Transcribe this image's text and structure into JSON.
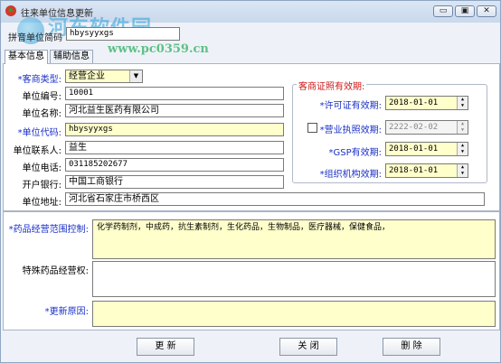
{
  "window": {
    "title": "往来单位信息更新",
    "controls": {
      "minimize": "▭",
      "restore": "▣",
      "close": "✕"
    }
  },
  "watermark": {
    "text": "河东软件园",
    "url": "www.pc0359.cn"
  },
  "search": {
    "label": "拼音单位简码",
    "value": "hbysyyxgs"
  },
  "tabs": [
    {
      "label": "基本信息",
      "active": true
    },
    {
      "label": "辅助信息",
      "active": false
    }
  ],
  "form": {
    "type": {
      "label": "*客商类型:",
      "value": "经营企业"
    },
    "code": {
      "label": "单位编号:",
      "value": "10001"
    },
    "name": {
      "label": "单位名称:",
      "value": "河北益生医药有限公司"
    },
    "dcode": {
      "label": "*单位代码:",
      "value": "hbysyyxgs"
    },
    "contact": {
      "label": "单位联系人:",
      "value": "益生"
    },
    "phone": {
      "label": "单位电话:",
      "value": "031185202677"
    },
    "bank": {
      "label": "开户银行:",
      "value": "中国工商银行"
    },
    "address": {
      "label": "单位地址:",
      "value": "河北省石家庄市桥西区"
    }
  },
  "licenses": {
    "title": "客商证照有效期:",
    "items": [
      {
        "label": "*许可证有效期:",
        "value": "2018-01-01",
        "enabled": true
      },
      {
        "label": "*营业执照效期:",
        "value": "2222-02-02",
        "enabled": false,
        "checkbox": true
      },
      {
        "label": "*GSP有效期:",
        "value": "2018-01-01",
        "enabled": true
      },
      {
        "label": "*组织机构效期:",
        "value": "2018-01-01",
        "enabled": true
      }
    ]
  },
  "scope": {
    "drug_label": "*药品经营范围控制:",
    "drug_value": "化学药制剂，中成药，抗生素制剂，生化药品，生物制品，医疗器械，保健食品，",
    "special_label": "特殊药品经营权:",
    "special_value": "",
    "reason_label": "*更新原因:",
    "reason_value": ""
  },
  "buttons": {
    "update": "更 新",
    "close": "关 闭",
    "delete": "删 除"
  },
  "colors": {
    "required_label": "#1a30c8",
    "group_title": "#cc1a1a",
    "required_field": "#ffffcc"
  }
}
